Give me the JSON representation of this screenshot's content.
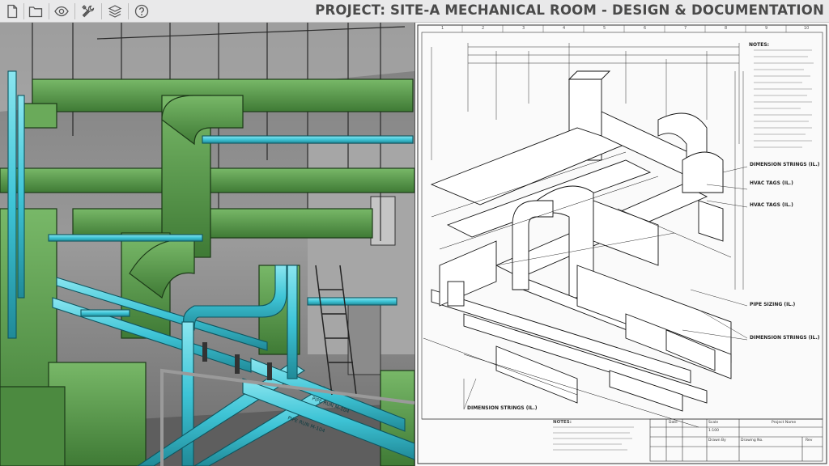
{
  "title": "PROJECT: SITE-A MECHANICAL ROOM - DESIGN & DOCUMENTATION",
  "toolbar": {
    "icons": [
      "document-icon",
      "folder-icon",
      "eye-icon",
      "tools-icon",
      "layers-icon",
      "help-icon"
    ]
  },
  "colors": {
    "duct_green": "#5a9a4e",
    "pipe_cyan": "#3ec4d6",
    "toolbar_bg": "#e9e9ea",
    "title_text": "#4a4a4a"
  },
  "model_labels": [
    "PIPE RUN M-104",
    "PIPE RUN M-104"
  ],
  "drawing": {
    "callouts": [
      "NOTES:",
      "DIMENSION STRINGS (IL.)",
      "HVAC TAGS (IL.)",
      "HVAC TAGS (IL.)",
      "PIPE SIZING (IL.)",
      "DIMENSION STRINGS (IL.)",
      "DIMENSION STRINGS (IL.)"
    ],
    "notes_label": "NOTES:",
    "bottom_notes_label": "NOTES:",
    "column_markers": [
      "1",
      "2",
      "3",
      "4",
      "5",
      "6",
      "7",
      "8",
      "9",
      "10"
    ],
    "title_block": {
      "project_name_label": "Project Name",
      "scale_label": "Scale",
      "scale_value": "1:100",
      "drawn_by_label": "Drawn By",
      "drawing_no_label": "Drawing No.",
      "date_label": "Date",
      "rev_label": "Rev"
    }
  }
}
